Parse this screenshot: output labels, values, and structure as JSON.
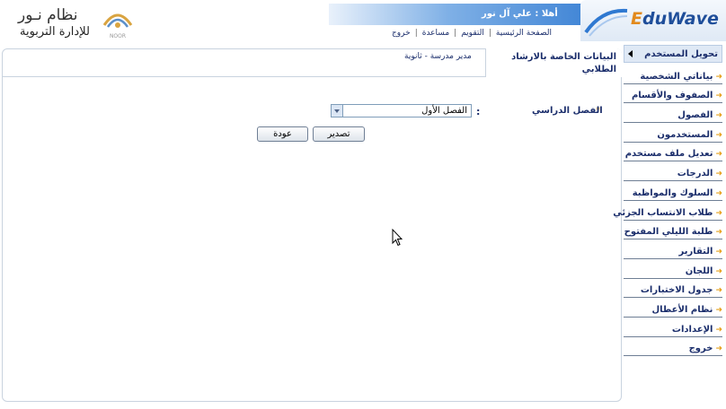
{
  "header": {
    "system_name": "نظام نـور",
    "system_subtitle": "للإدارة التربوية",
    "logo_caption": "NOOR",
    "greeting": "أهلا : علي آل نور",
    "menu": [
      "الصفحة الرئيسية",
      "التقويم",
      "مساعدة",
      "خروج"
    ],
    "brand": "duWave",
    "brand_initial": "E",
    "colors": {
      "banner": "#2f79d1",
      "text": "#1a2d6b",
      "accent": "#e6a11b"
    }
  },
  "sidebar": {
    "header_label": "تحويل المستخدم",
    "items": [
      "بياناتي الشخصية",
      "الصفوف والأقسام",
      "الفصول",
      "المستخدمون",
      "تعديل ملف مستخدم",
      "الدرجات",
      "السلوك والمواظبة",
      "طلاب الانتساب الجزئي",
      "طلبة الليلي المفتوح",
      "التقارير",
      "اللجان",
      "جدول الاختبارات",
      "نظام الأعطال",
      "الإعدادات",
      "خروج"
    ]
  },
  "main": {
    "title": "البيانات الخاصة بالارشاد الطلابي",
    "role": "مدير مدرسة - ثانوية",
    "form": {
      "required_mark": "*",
      "semester_label": "الفصل الدراسي",
      "colon": ":",
      "semester_value": "الفصل الأول"
    },
    "buttons": {
      "export": "تصدير",
      "back": "عودة"
    }
  }
}
